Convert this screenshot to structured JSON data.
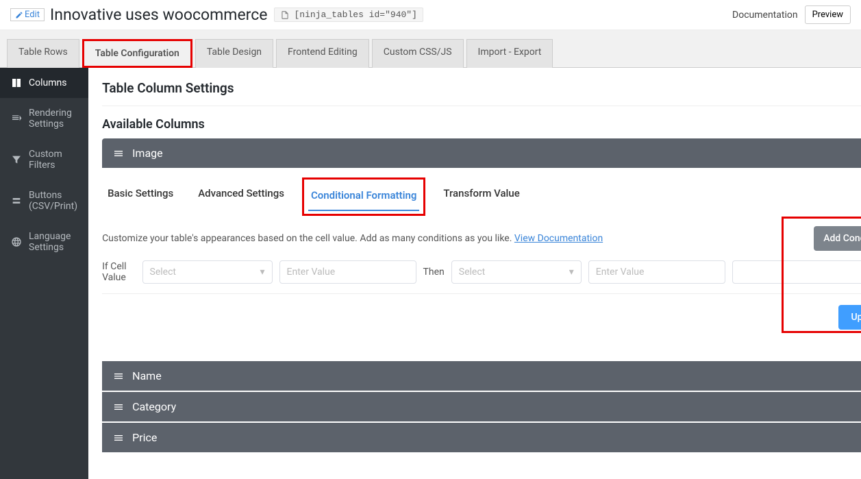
{
  "header": {
    "edit_label": "Edit",
    "title": "Innovative uses woocommerce",
    "shortcode": "[ninja_tables id=\"940\"]",
    "documentation_label": "Documentation",
    "preview_label": "Preview"
  },
  "tabs": [
    {
      "label": "Table Rows"
    },
    {
      "label": "Table Configuration",
      "active": true,
      "highlighted": true
    },
    {
      "label": "Table Design"
    },
    {
      "label": "Frontend Editing"
    },
    {
      "label": "Custom CSS/JS"
    },
    {
      "label": "Import - Export"
    }
  ],
  "sidebar": {
    "items": [
      {
        "label": "Columns",
        "icon": "columns",
        "active": true
      },
      {
        "label": "Rendering Settings",
        "icon": "rendering"
      },
      {
        "label": "Custom Filters",
        "icon": "filter"
      },
      {
        "label": "Buttons (CSV/Print)",
        "icon": "buttons"
      },
      {
        "label": "Language Settings",
        "icon": "language"
      }
    ]
  },
  "main": {
    "section_title": "Table Column Settings",
    "available_columns_title": "Available Columns",
    "columns": [
      {
        "title": "Image"
      },
      {
        "title": "Name"
      },
      {
        "title": "Category"
      },
      {
        "title": "Price"
      }
    ],
    "image_panel": {
      "sub_tabs": [
        {
          "label": "Basic Settings"
        },
        {
          "label": "Advanced Settings"
        },
        {
          "label": "Conditional Formatting",
          "active": true,
          "highlighted": true
        },
        {
          "label": "Transform Value"
        }
      ],
      "helper_text_prefix": "Customize your table's appearances based on the cell value. Add as many conditions as you like. ",
      "helper_link_text": "View Documentation",
      "add_condition_label": "Add Condition",
      "if_label": "If Cell Value",
      "then_label": "Then",
      "select_placeholder": "Select",
      "enter_value_placeholder": "Enter Value",
      "remove_label": "—",
      "update_label": "Update"
    }
  }
}
